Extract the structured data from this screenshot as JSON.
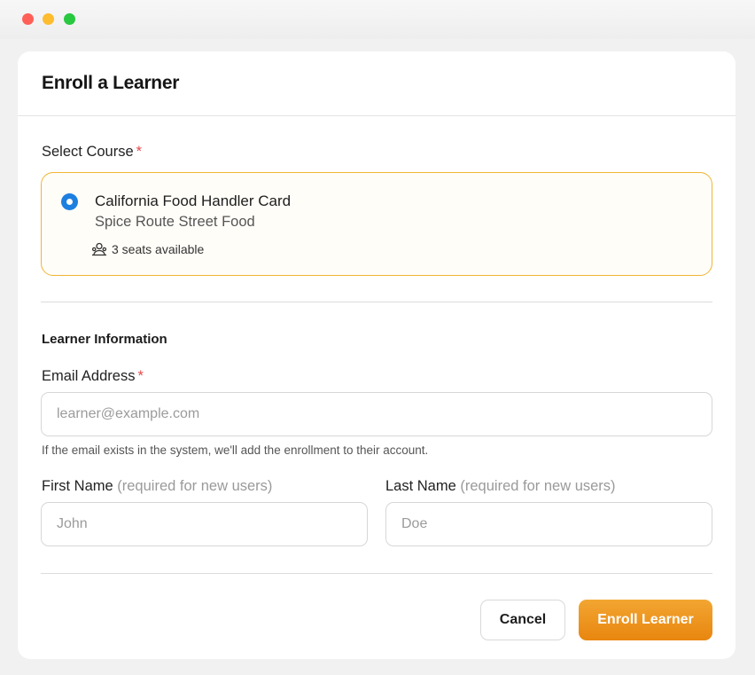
{
  "window": {
    "controls": [
      "close",
      "minimize",
      "maximize"
    ]
  },
  "dialog": {
    "title": "Enroll a Learner"
  },
  "course_section": {
    "label": "Select Course",
    "required_mark": "*",
    "selected_course": {
      "name": "California Food Handler Card",
      "vendor": "Spice Route Street Food",
      "seats": "3 seats available",
      "icon": "users-icon"
    }
  },
  "learner_section": {
    "heading": "Learner Information",
    "email": {
      "label": "Email Address",
      "required_mark": "*",
      "placeholder": "learner@example.com",
      "value": "",
      "help": "If the email exists in the system, we'll add the enrollment to their account."
    },
    "first_name": {
      "label": "First Name",
      "hint": "(required for new users)",
      "placeholder": "John",
      "value": ""
    },
    "last_name": {
      "label": "Last Name",
      "hint": "(required for new users)",
      "placeholder": "Doe",
      "value": ""
    }
  },
  "actions": {
    "cancel": "Cancel",
    "submit": "Enroll Learner"
  },
  "colors": {
    "accent": "#E8860F",
    "selected_border": "#F0B533",
    "radio": "#1D7FE0",
    "required": "#E5484D"
  }
}
